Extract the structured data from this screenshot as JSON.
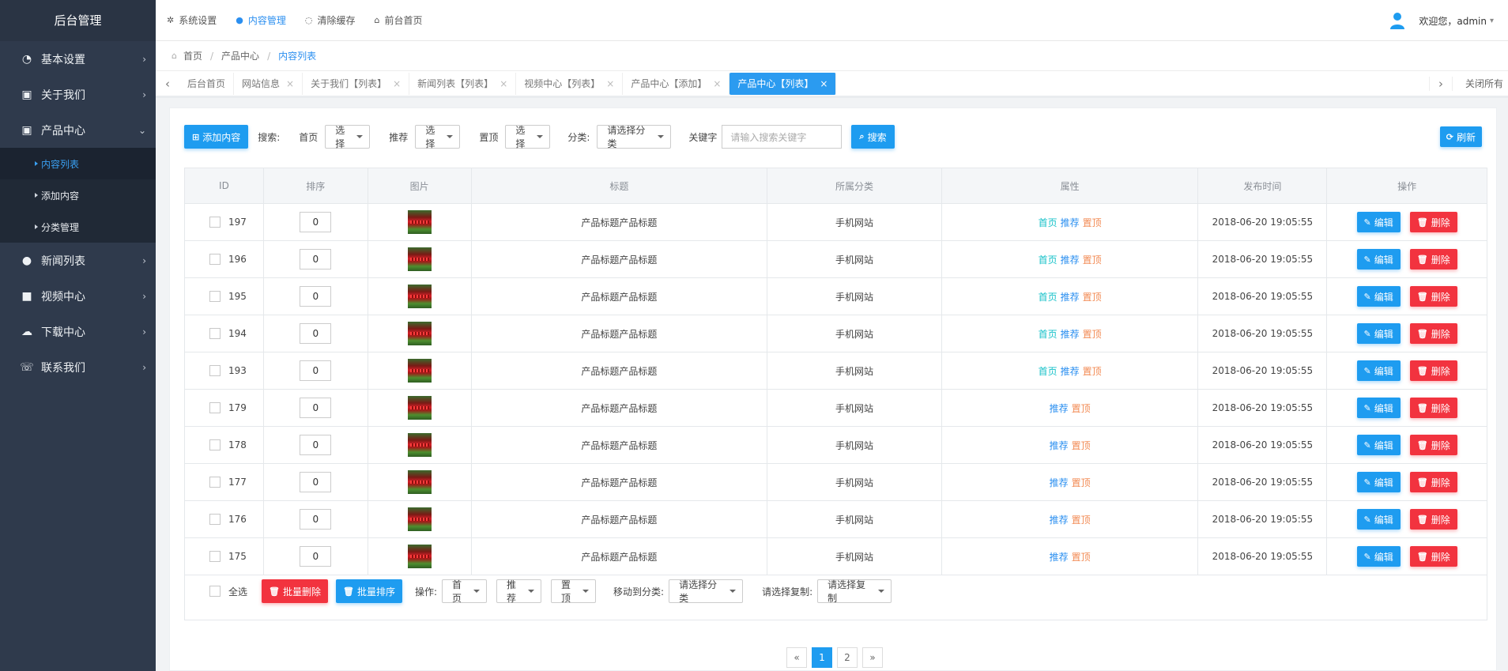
{
  "sidebar": {
    "brand": "后台管理",
    "items": [
      {
        "label": "基本设置",
        "icon": "dashboard-icon"
      },
      {
        "label": "关于我们",
        "icon": "briefcase-icon"
      },
      {
        "label": "产品中心",
        "icon": "briefcase-icon",
        "expanded": true,
        "children": [
          {
            "label": "内容列表",
            "active": true
          },
          {
            "label": "添加内容"
          },
          {
            "label": "分类管理"
          }
        ]
      },
      {
        "label": "新闻列表",
        "icon": "chat-bubble-icon"
      },
      {
        "label": "视频中心",
        "icon": "video-camera-icon"
      },
      {
        "label": "下载中心",
        "icon": "cloud-download-icon"
      },
      {
        "label": "联系我们",
        "icon": "phone-icon"
      }
    ]
  },
  "topbar": {
    "links": [
      {
        "label": "系统设置",
        "icon": "gear-icon"
      },
      {
        "label": "内容管理",
        "icon": "chat-bubble-icon",
        "active": true
      },
      {
        "label": "清除缓存",
        "icon": "leaf-icon"
      },
      {
        "label": "前台首页",
        "icon": "home-icon"
      }
    ],
    "welcome": "欢迎您，admin",
    "user_caret": "▾"
  },
  "breadcrumb": {
    "home": "首页",
    "sep": "/",
    "level1": "产品中心",
    "current": "内容列表"
  },
  "tabs": {
    "items": [
      {
        "label": "后台首页",
        "closable": false
      },
      {
        "label": "网站信息",
        "closable": true
      },
      {
        "label": "关于我们【列表】",
        "closable": true
      },
      {
        "label": "新闻列表【列表】",
        "closable": true
      },
      {
        "label": "视频中心【列表】",
        "closable": true
      },
      {
        "label": "产品中心【添加】",
        "closable": true
      },
      {
        "label": "产品中心【列表】",
        "closable": true,
        "active": true
      }
    ],
    "close_all": "关闭所有"
  },
  "toolbar": {
    "add_label": "添加内容",
    "search_label": "搜索:",
    "home_label": "首页",
    "home_select": "选择",
    "rec_label": "推荐",
    "rec_select": "选择",
    "top_label": "置顶",
    "top_select": "选择",
    "cat_label": "分类:",
    "cat_select": "请选择分类",
    "keyword_label": "关键字",
    "keyword_placeholder": "请输入搜索关键字",
    "search_button": "搜索",
    "refresh_button": "刷新"
  },
  "table": {
    "headers": [
      "ID",
      "排序",
      "图片",
      "标题",
      "所属分类",
      "属性",
      "发布时间",
      "操作"
    ],
    "attr_labels": {
      "home": "首页",
      "rec": "推荐",
      "top": "置顶"
    },
    "edit_label": "编辑",
    "delete_label": "删除",
    "rows": [
      {
        "id": "197",
        "sort": "0",
        "title": "产品标题产品标题",
        "category": "手机网站",
        "home": true,
        "time": "2018-06-20 19:05:55"
      },
      {
        "id": "196",
        "sort": "0",
        "title": "产品标题产品标题",
        "category": "手机网站",
        "home": true,
        "time": "2018-06-20 19:05:55"
      },
      {
        "id": "195",
        "sort": "0",
        "title": "产品标题产品标题",
        "category": "手机网站",
        "home": true,
        "time": "2018-06-20 19:05:55"
      },
      {
        "id": "194",
        "sort": "0",
        "title": "产品标题产品标题",
        "category": "手机网站",
        "home": true,
        "time": "2018-06-20 19:05:55"
      },
      {
        "id": "193",
        "sort": "0",
        "title": "产品标题产品标题",
        "category": "手机网站",
        "home": true,
        "time": "2018-06-20 19:05:55"
      },
      {
        "id": "179",
        "sort": "0",
        "title": "产品标题产品标题",
        "category": "手机网站",
        "home": false,
        "time": "2018-06-20 19:05:55"
      },
      {
        "id": "178",
        "sort": "0",
        "title": "产品标题产品标题",
        "category": "手机网站",
        "home": false,
        "time": "2018-06-20 19:05:55"
      },
      {
        "id": "177",
        "sort": "0",
        "title": "产品标题产品标题",
        "category": "手机网站",
        "home": false,
        "time": "2018-06-20 19:05:55"
      },
      {
        "id": "176",
        "sort": "0",
        "title": "产品标题产品标题",
        "category": "手机网站",
        "home": false,
        "time": "2018-06-20 19:05:55"
      },
      {
        "id": "175",
        "sort": "0",
        "title": "产品标题产品标题",
        "category": "手机网站",
        "home": false,
        "time": "2018-06-20 19:05:55"
      }
    ]
  },
  "bulk": {
    "select_all": "全选",
    "batch_delete": "批量删除",
    "batch_sort": "批量排序",
    "op_label": "操作:",
    "op_home": "首页",
    "op_rec": "推荐",
    "op_top": "置顶",
    "move_label": "移动到分类:",
    "move_select": "请选择分类",
    "copy_label": "请选择复制:",
    "copy_select": "请选择复制"
  },
  "pager": {
    "prev": "«",
    "pages": [
      "1",
      "2"
    ],
    "current": "1",
    "next": "»"
  },
  "colors": {
    "sidebar_bg": "#2f3a4c",
    "primary": "#1e9cf0",
    "danger": "#f2333f",
    "attr_home": "#17c2c9",
    "attr_top": "#f28a53"
  }
}
